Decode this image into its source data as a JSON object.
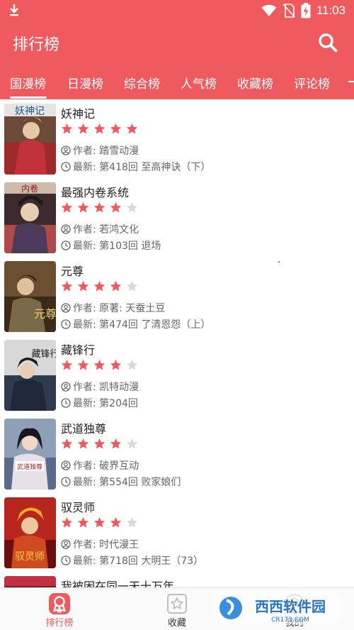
{
  "status_bar": {
    "time": "11:03",
    "download_icon": "download-icon",
    "wifi_icon": "wifi-icon",
    "no_sim_icon": "no-sim-icon",
    "battery_icon": "battery-charging-icon"
  },
  "app_bar": {
    "title": "排行榜",
    "search_icon": "search-icon"
  },
  "colors": {
    "accent": "#ef5a5e",
    "star_filled": "#ee5a5e",
    "star_empty": "#d9d9d9"
  },
  "tabs": [
    {
      "label": "国漫榜",
      "active": true
    },
    {
      "label": "日漫榜",
      "active": false
    },
    {
      "label": "综合榜",
      "active": false
    },
    {
      "label": "人气榜",
      "active": false
    },
    {
      "label": "收藏榜",
      "active": false
    },
    {
      "label": "评论榜",
      "active": false
    }
  ],
  "comics": [
    {
      "title": "妖神记",
      "rating": 5,
      "author": "作者:  踏雪动漫",
      "latest": "最新:  第418回 至高神诀（下）",
      "cover_text": "妖神记"
    },
    {
      "title": "最强内卷系统",
      "rating": 4,
      "author": "作者:  若鸿文化",
      "latest": "最新:  第103回 退场",
      "cover_text": "内卷"
    },
    {
      "title": "元尊",
      "rating": 4,
      "author": "作者:  原著:  天蚕土豆",
      "latest": "最新:  第474回 了清恩怨（上）",
      "cover_text": "元尊"
    },
    {
      "title": "藏锋行",
      "rating": 4,
      "author": "作者:  凯特动漫",
      "latest": "最新:  第204回",
      "cover_text": "藏锋行"
    },
    {
      "title": "武道独尊",
      "rating": 4,
      "author": "作者:  破界互动",
      "latest": "最新:  第554回 败家娘们",
      "cover_text": "武道独尊"
    },
    {
      "title": "驭灵师",
      "rating": 4,
      "author": "作者:  时代漫王",
      "latest": "最新:  第718回 大明王（73）",
      "cover_text": "驭灵师"
    },
    {
      "title": "我被困在同一天十万年",
      "rating": 0,
      "author": "",
      "latest": "",
      "cover_text": ""
    }
  ],
  "bottom_nav": [
    {
      "label": "排行榜",
      "icon": "ranking-icon",
      "active": true
    },
    {
      "label": "收藏",
      "icon": "favorites-icon",
      "active": false
    },
    {
      "label": "我的",
      "icon": "profile-icon",
      "active": false
    }
  ],
  "watermark": {
    "text": "西西软件园",
    "subtext": "CR173.COM"
  }
}
